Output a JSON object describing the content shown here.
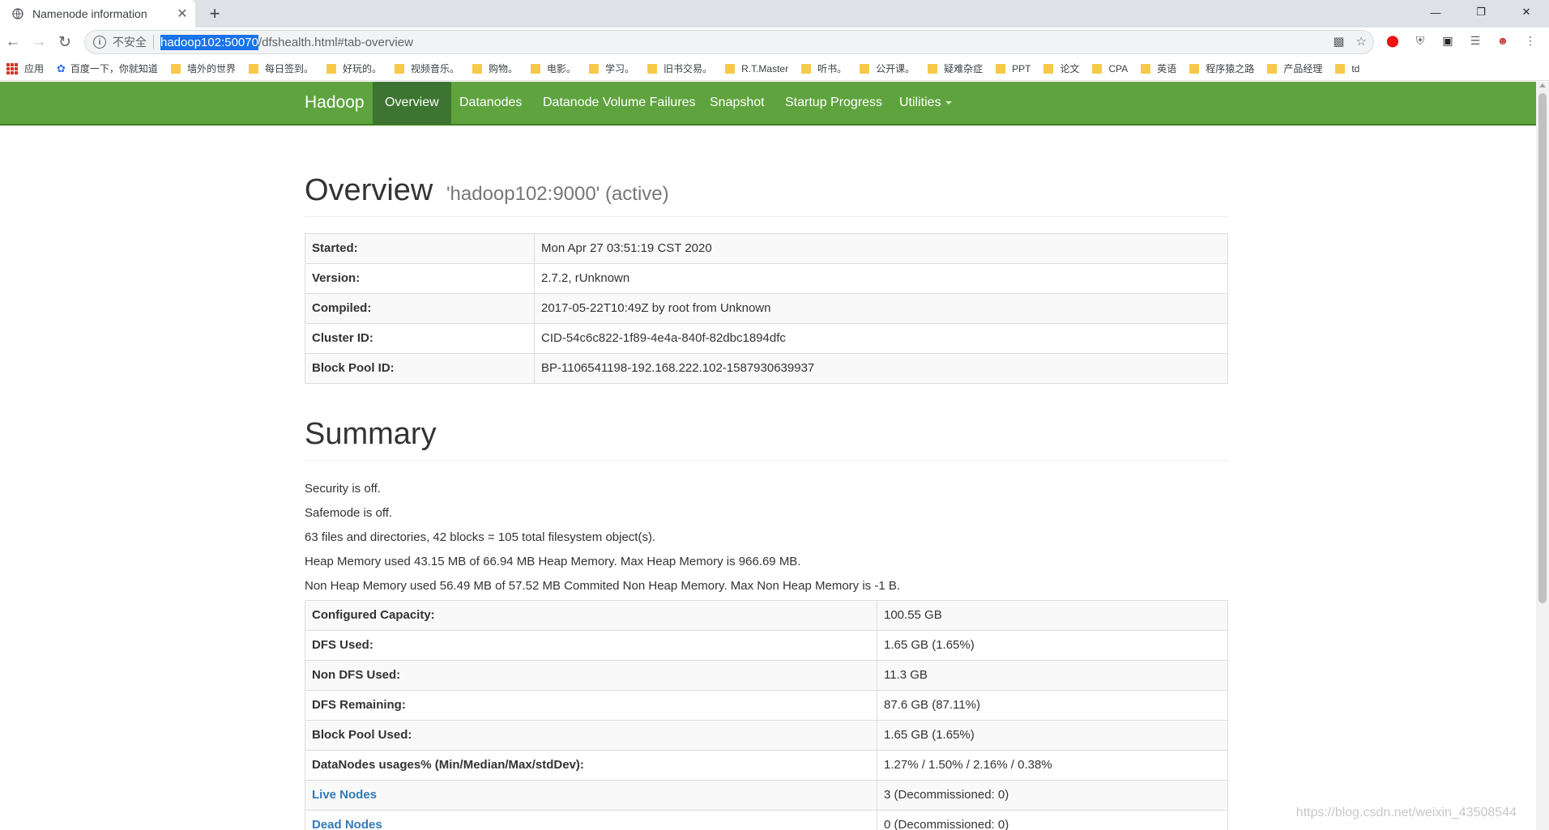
{
  "browser": {
    "tab_title": "Namenode information",
    "tab_close": "✕",
    "new_tab": "+",
    "url_insecure_label": "不安全",
    "url_host": "hadoop102:50070",
    "url_path": "/dfshealth.html#tab-overview",
    "bookmarks": [
      "应用",
      "百度一下，你就知道",
      "墙外的世界",
      "每日签到。",
      "好玩的。",
      "视频音乐。",
      "购物。",
      "电影。",
      "学习。",
      "旧书交易。",
      "R.T.Master",
      "听书。",
      "公开课。",
      "疑难杂症",
      "PPT",
      "论文",
      "CPA",
      "英语",
      "程序猿之路",
      "产品经理",
      "td"
    ]
  },
  "navbar": {
    "brand": "Hadoop",
    "items": [
      "Overview",
      "Datanodes",
      "Datanode Volume Failures",
      "Snapshot",
      "Startup Progress",
      "Utilities"
    ]
  },
  "overview": {
    "title": "Overview",
    "subtitle": "'hadoop102:9000' (active)",
    "rows": [
      {
        "k": "Started:",
        "v": "Mon Apr 27 03:51:19 CST 2020"
      },
      {
        "k": "Version:",
        "v": "2.7.2, rUnknown"
      },
      {
        "k": "Compiled:",
        "v": "2017-05-22T10:49Z by root from Unknown"
      },
      {
        "k": "Cluster ID:",
        "v": "CID-54c6c822-1f89-4e4a-840f-82dbc1894dfc"
      },
      {
        "k": "Block Pool ID:",
        "v": "BP-1106541198-192.168.222.102-1587930639937"
      }
    ]
  },
  "summary": {
    "title": "Summary",
    "lines": [
      "Security is off.",
      "Safemode is off.",
      "63 files and directories, 42 blocks = 105 total filesystem object(s).",
      "Heap Memory used 43.15 MB of 66.94 MB Heap Memory. Max Heap Memory is 966.69 MB.",
      "Non Heap Memory used 56.49 MB of 57.52 MB Commited Non Heap Memory. Max Non Heap Memory is -1 B."
    ],
    "rows": [
      {
        "k": "Configured Capacity:",
        "v": "100.55 GB"
      },
      {
        "k": "DFS Used:",
        "v": "1.65 GB (1.65%)"
      },
      {
        "k": "Non DFS Used:",
        "v": "11.3 GB"
      },
      {
        "k": "DFS Remaining:",
        "v": "87.6 GB (87.11%)"
      },
      {
        "k": "Block Pool Used:",
        "v": "1.65 GB (1.65%)"
      },
      {
        "k": "DataNodes usages% (Min/Median/Max/stdDev):",
        "v": "1.27% / 1.50% / 2.16% / 0.38%"
      },
      {
        "k": "Live Nodes",
        "v": "3 (Decommissioned: 0)"
      },
      {
        "k": "Dead Nodes",
        "v": "0 (Decommissioned: 0)"
      }
    ]
  },
  "watermark": "https://blog.csdn.net/weixin_43508544"
}
